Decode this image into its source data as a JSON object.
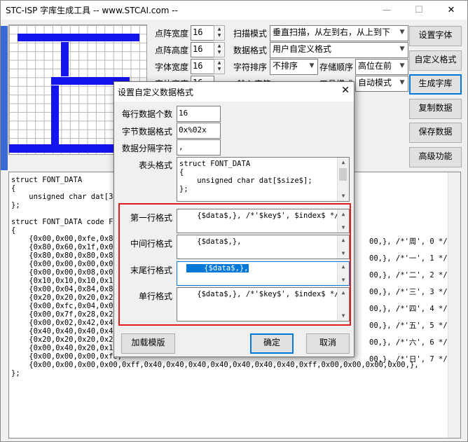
{
  "window": {
    "title": "STC-ISP 字库生成工具 -- www.STCAI.com --",
    "minimize": "—",
    "maximize": "☐",
    "close": "✕"
  },
  "settings": {
    "dot_width_label": "点阵宽度",
    "dot_width": "16",
    "dot_height_label": "点阵高度",
    "dot_height": "16",
    "font_width_label": "字体宽度",
    "font_width": "16",
    "font_height_label": "字体高度",
    "font_height": "16",
    "scan_mode_label": "扫描模式",
    "scan_mode": "垂直扫描，从左到右，从上到下",
    "data_format_label": "数据格式",
    "data_format": "用户自定义格式",
    "char_sort_label": "字符排序",
    "char_sort": "不排序",
    "store_order_label": "存储顺序",
    "store_order": "高位在前",
    "input_label": "输入字符",
    "work_mode_label": "工具模式",
    "work_mode": "自动模式"
  },
  "buttons": {
    "set_font": "设置字体",
    "custom_format": "自定义格式",
    "generate": "生成字库",
    "copy": "复制数据",
    "save": "保存数据",
    "advanced": "高级功能"
  },
  "output": {
    "lines": [
      "struct FONT_DATA",
      "{",
      "    unsigned char dat[32",
      "};",
      "",
      "struct FONT_DATA code For",
      "{",
      "    {0x00,0x00,0xfe,0x82,",
      "    {0x80,0x60,0x1f,0x00,",
      "    {0x80,0x80,0x80,0x80,",
      "    {0x00,0x00,0x00,0x00,",
      "    {0x00,0x00,0x08,0x08,",
      "    {0x10,0x10,0x10,0x10,",
      "    {0x00,0x04,0x84,0x84,",
      "    {0x20,0x20,0x20,0x20,",
      "    {0x00,0xfc,0x04,0x04,",
      "    {0x00,0x7f,0x28,0x24,",
      "    {0x00,0x02,0x42,0x42,",
      "    {0x40,0x40,0x40,0x40,",
      "    {0x20,0x20,0x20,0x20,",
      "    {0x00,0x40,0x20,0x10,",
      "    {0x00,0x00,0x00,0xfe,",
      "    {0x00,0x00,0x00,0x00,0xff,0x40,0x40,0x40,0x40,0x40,0x40,0x40,0xff,0x00,0x00,0x00,0x00,},",
      "};"
    ],
    "right_lines": [
      "00,}, /*'周', 0 */",
      "00,}, /*'一', 1 */",
      "00,}, /*'二', 2 */",
      "00,}, /*'三', 3 */",
      "00,}, /*'四', 4 */",
      "00,}, /*'五', 5 */",
      "00,}, /*'六', 6 */",
      "00,}, /*'日', 7 */"
    ]
  },
  "dialog": {
    "title": "设置自定义数据格式",
    "close": "✕",
    "per_line_label": "每行数据个数",
    "per_line": "16",
    "byte_format_label": "字节数据格式",
    "byte_format": "0x%02x",
    "separator_label": "数据分隔字符",
    "separator": ",",
    "header_label": "表头格式",
    "header_lines": [
      "struct FONT_DATA",
      "{",
      "    unsigned char dat[$size$];",
      "};",
      "",
      "struct FONT_DATA code Font[]"
    ],
    "first_label": "第一行格式",
    "first": "    {$data$,}, /*'$key$', $index$ */",
    "middle_label": "中间行格式",
    "middle": "    {$data$,},",
    "last_label": "末尾行格式",
    "last": "    {$data$,},",
    "single_label": "单行格式",
    "single": "    {$data$,}, /*'$key$', $index$ */",
    "load_template": "加载模版",
    "ok": "确定",
    "cancel": "取消"
  }
}
